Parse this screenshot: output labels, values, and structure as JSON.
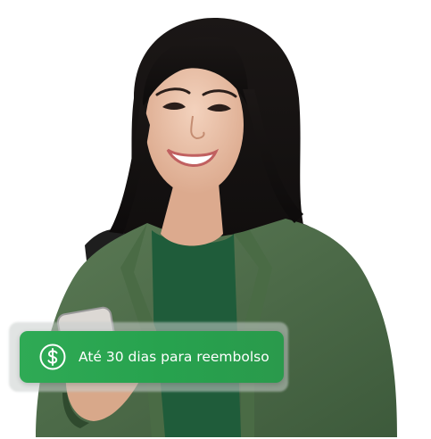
{
  "badge": {
    "icon": "dollar-circle-icon",
    "text": "Até 30 dias para reembolso",
    "color": "#2faa55"
  },
  "photo": {
    "subject": "person-holding-phone"
  }
}
